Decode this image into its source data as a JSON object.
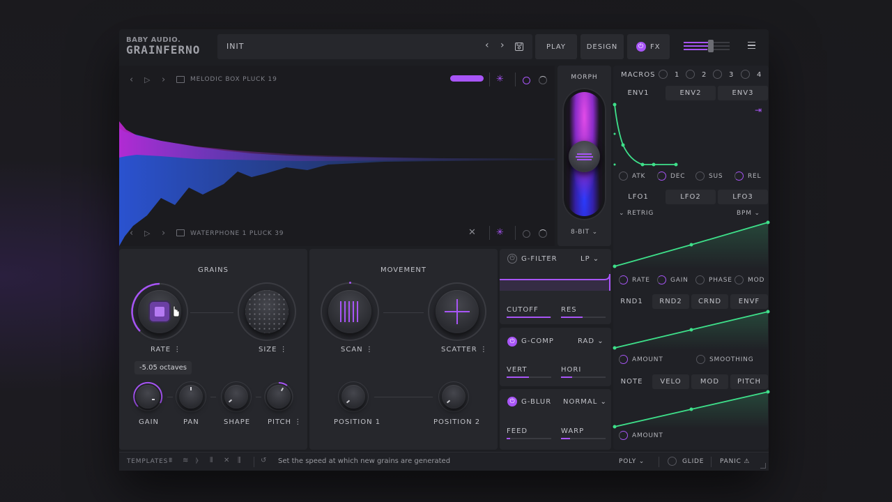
{
  "brand": {
    "company": "BABY AUDIO.",
    "product": "GRAINFERNO"
  },
  "header": {
    "preset_name": "INIT",
    "play_label": "PLAY",
    "design_label": "DESIGN",
    "fx_label": "FX"
  },
  "sample_a": {
    "name": "MELODIC BOX PLUCK 19"
  },
  "sample_b": {
    "name": "WATERPHONE 1 PLUCK 39"
  },
  "morph": {
    "title": "MORPH",
    "mode": "8-BIT"
  },
  "grains": {
    "title": "GRAINS",
    "rate_label": "RATE",
    "size_label": "SIZE",
    "tooltip": "-5.05 octaves",
    "gain_label": "GAIN",
    "pan_label": "PAN",
    "shape_label": "SHAPE",
    "pitch_label": "PITCH"
  },
  "movement": {
    "title": "MOVEMENT",
    "scan_label": "SCAN",
    "scatter_label": "SCATTER",
    "pos1_label": "POSITION 1",
    "pos2_label": "POSITION 2"
  },
  "gfilter": {
    "title": "G-FILTER",
    "mode": "LP",
    "cutoff_label": "CUTOFF",
    "res_label": "RES",
    "cutoff": 0.98,
    "res": 0.48
  },
  "gcomp": {
    "title": "G-COMP",
    "mode": "RAD",
    "vert_label": "VERT",
    "hori_label": "HORI",
    "vert": 0.5,
    "hori": 0.25
  },
  "gblur": {
    "title": "G-BLUR",
    "mode": "NORMAL",
    "feed_label": "FEED",
    "warp_label": "WARP",
    "feed": 0.08,
    "warp": 0.2
  },
  "macros": {
    "title": "MACROS",
    "items": [
      "1",
      "2",
      "3",
      "4"
    ]
  },
  "env": {
    "tabs": [
      "ENV1",
      "ENV2",
      "ENV3"
    ],
    "params": [
      "ATK",
      "DEC",
      "SUS",
      "REL"
    ]
  },
  "lfo": {
    "tabs": [
      "LFO1",
      "LFO2",
      "LFO3"
    ],
    "retrig_label": "RETRIG",
    "sync_label": "BPM",
    "params": [
      "RATE",
      "GAIN",
      "PHASE",
      "MOD"
    ]
  },
  "rnd": {
    "tabs": [
      "RND1",
      "RND2",
      "CRND",
      "ENVF"
    ],
    "amount_label": "AMOUNT",
    "smoothing_label": "SMOOTHING"
  },
  "note": {
    "tabs": [
      "NOTE",
      "VELO",
      "MOD",
      "PITCH"
    ],
    "amount_label": "AMOUNT"
  },
  "footer": {
    "templates_label": "TEMPLATES",
    "hint": "Set the speed at which new grains are generated",
    "voice_mode": "POLY",
    "glide_label": "GLIDE",
    "panic_label": "PANIC"
  },
  "colors": {
    "accent": "#a855f7",
    "mod_green": "#3ee08a",
    "bg": "#1d1e22"
  }
}
